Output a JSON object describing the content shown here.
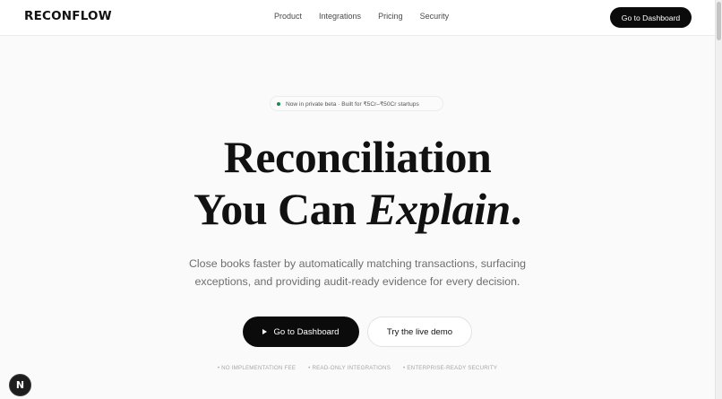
{
  "header": {
    "logo": "RECONFLOW",
    "nav": [
      "Product",
      "Integrations",
      "Pricing",
      "Security"
    ],
    "cta_label": "Go to Dashboard"
  },
  "hero": {
    "badge_text": "Now in private beta · Built for ₹5Cr–₹50Cr startups",
    "headline_line1": "Reconciliation",
    "headline_line2_prefix": "You Can ",
    "headline_line2_italic": "Explain",
    "headline_line2_suffix": ".",
    "subtitle": "Close books faster by automatically matching transactions, surfacing exceptions, and providing audit-ready evidence for every decision.",
    "primary_button": "Go to Dashboard",
    "secondary_button": "Try the live demo",
    "features": [
      "• NO IMPLEMENTATION FEE",
      "• READ-ONLY INTEGRATIONS",
      "• ENTERPRISE-READY SECURITY"
    ]
  },
  "floating_badge": "N",
  "colors": {
    "accent": "#0b0b0b",
    "badge_dot": "#1c8a4c",
    "background": "#fafafa"
  }
}
